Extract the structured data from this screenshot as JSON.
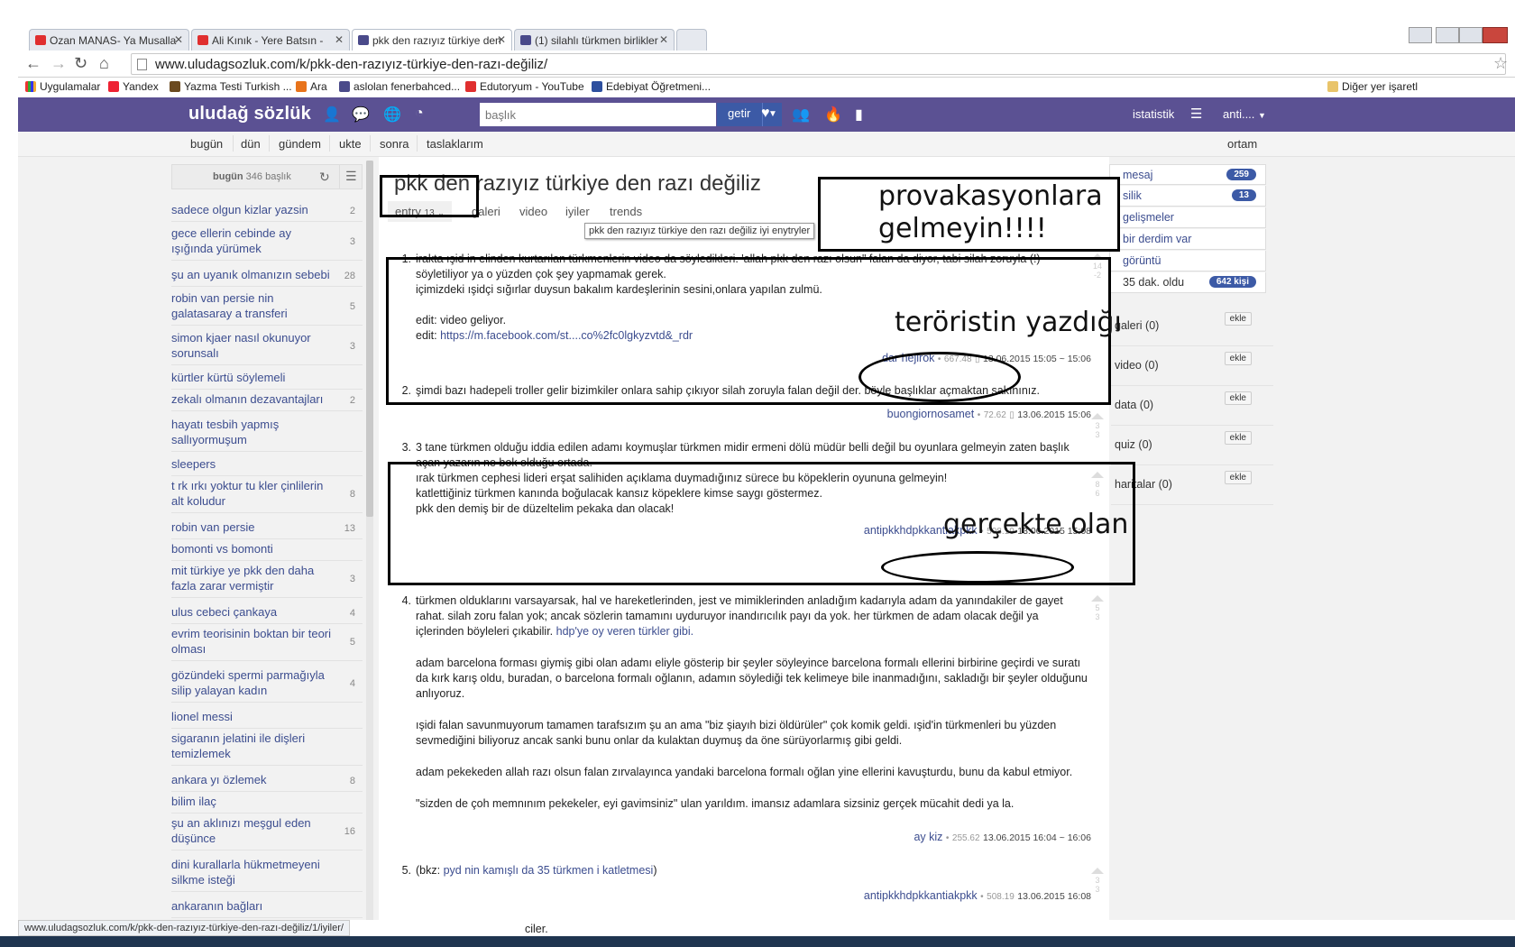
{
  "browser": {
    "tabs": [
      {
        "label": "Ozan MANAS- Ya Musalla",
        "icon": "youtube-icon"
      },
      {
        "label": "Ali Kınık - Yere Batsın - ",
        "icon": "youtube-icon"
      },
      {
        "label": "pkk den razıyız türkiye den",
        "icon": "uludag-icon"
      },
      {
        "label": "(1) silahlı türkmen birlikler",
        "icon": "uludag-icon"
      }
    ],
    "url": "www.uludagsozluk.com/k/pkk-den-razıyız-türkiye-den-razı-değiliz/",
    "bookmarks": [
      "Uygulamalar",
      "Yandex",
      "Yazma Testi Turkish ...",
      "Ara",
      "aslolan fenerbahced...",
      "Edutoryum - YouTube",
      "Edebiyat Öğretmeni..."
    ],
    "other_bookmarks": "Diğer yer işaretl",
    "status_url": "www.uludagsozluk.com/k/pkk-den-razıyız-türkiye-den-razı-değiliz/1/iyiler/"
  },
  "header": {
    "logo": "uludağ sözlük",
    "search_placeholder": "başlık",
    "search_button": "getir",
    "stats": "istatistik",
    "user": "anti....",
    "colors": {
      "header_bg": "#5b5193",
      "button_bg": "#3c5aa6"
    }
  },
  "subnav": {
    "items": [
      "bugün",
      "dün",
      "gündem",
      "ukte",
      "sonra",
      "taslaklarım"
    ],
    "right": "ortam"
  },
  "sidebar": {
    "head_label": "bugün",
    "head_count": "346 başlık",
    "items": [
      {
        "label": "sadece olgun kizlar yazsin",
        "count": "2"
      },
      {
        "label": "gece ellerin cebinde ay ışığında yürümek",
        "count": "3"
      },
      {
        "label": "şu an uyanık olmanızın sebebi",
        "count": "28"
      },
      {
        "label": "robin van persie nin galatasaray a transferi",
        "count": "5"
      },
      {
        "label": "simon kjaer nasıl okunuyor sorunsalı",
        "count": "3"
      },
      {
        "label": "kürtler kürtü söylemeli",
        "count": ""
      },
      {
        "label": "zekalı olmanın dezavantajları",
        "count": "2"
      },
      {
        "label": "hayatı tesbih yapmış sallıyormuşum",
        "count": ""
      },
      {
        "label": "sleepers",
        "count": ""
      },
      {
        "label": "t rk ırkı yoktur tu kler çinlilerin alt koludur",
        "count": "8"
      },
      {
        "label": "robin van persie",
        "count": "13"
      },
      {
        "label": "bomonti vs bomonti",
        "count": ""
      },
      {
        "label": "mit türkiye ye pkk den daha fazla zarar vermiştir",
        "count": "3"
      },
      {
        "label": "ulus cebeci çankaya",
        "count": "4"
      },
      {
        "label": "evrim teorisinin boktan bir teori olması",
        "count": "5"
      },
      {
        "label": "gözündeki spermi parmağıyla silip yalayan kadın",
        "count": "4"
      },
      {
        "label": "lionel messi",
        "count": ""
      },
      {
        "label": "sigaranın jelatini ile dişleri temizlemek",
        "count": ""
      },
      {
        "label": "ankara yı özlemek",
        "count": "8"
      },
      {
        "label": "bilim ilaç",
        "count": ""
      },
      {
        "label": "şu an aklınızı meşgul eden düşünce",
        "count": "16"
      },
      {
        "label": "dini kurallarla hükmetmeyeni silkme isteği",
        "count": ""
      },
      {
        "label": "ankaranın bağları",
        "count": ""
      }
    ]
  },
  "topic": {
    "title": "pkk den razıyız türkiye den razı değiliz",
    "tabs": {
      "entry": "entry",
      "entry_count": "13",
      "galeri": "galeri",
      "video": "video",
      "iyiler": "iyiler",
      "trends": "trends"
    },
    "tooltip": "pkk den razıyız türkiye den razı değiliz iyi enytryler",
    "ara": "ara"
  },
  "entries": [
    {
      "num": "1.",
      "lines": [
        "irakta ışid in elinden kurtarılan türkmenlerin video da söyledikleri. 'allah pkk den razı olsun\" falan da diyor, tabi silah zoruyla (!) söyletiliyor ya o yüzden çok şey yapmamak gerek.",
        "içimizdeki ışidçi sığırlar duysun bakalım kardeşlerinin sesini,onlara yapılan zulmü.",
        "",
        "edit: video geliyor."
      ],
      "edit_prefix": "edit: ",
      "edit_link": "https://m.facebook.com/st....co%2fc0lgkyzvtd&_rdr",
      "author": "dar hejirok",
      "score": "667.48",
      "date": "13.06.2015 15:05 ~ 15:06",
      "votes": [
        "14",
        "-2"
      ]
    },
    {
      "num": "2.",
      "lines": [
        "şimdi bazı hadepeli troller gelir bizimkiler onlara sahip çıkıyor silah zoruyla falan değil der. böyle başlıklar açmaktan sakınınız."
      ],
      "author": "buongiornosamet",
      "score": "72.62",
      "date": "13.06.2015 15:06",
      "votes": [
        "3",
        "3"
      ]
    },
    {
      "num": "3.",
      "lines": [
        "3 tane türkmen olduğu iddia edilen adamı koymuşlar türkmen midir ermeni dölü müdür belli değil bu oyunlara gelmeyin zaten başlık açan yazarın ne bok olduğu ortada.",
        "ırak türkmen cephesi lideri erşat salihiden açıklama duymadığınız sürece bu köpeklerin oyununa gelmeyin!",
        "katlettiğiniz türkmen kanında boğulacak kansız köpeklere kimse saygı göstermez.",
        "pkk den demiş bir de düzeltelim pekaka dan olacak!"
      ],
      "author": "antipkkhdpkkantiakpkk",
      "score": "508.19",
      "date": "13.06.2015 15:08",
      "votes": [
        "8",
        "6"
      ]
    },
    {
      "num": "4.",
      "paragraphs": [
        "türkmen olduklarını varsayarsak, hal ve hareketlerinden, jest ve mimiklerinden anladığım kadarıyla adam da yanındakiler de gayet rahat. silah zoru falan yok; ancak sözlerin tamamını uyduruyor inandırıcılık payı da yok. her türkmen de adam olacak değil ya içlerinden böyleleri çıkabilir.",
        "adam barcelona forması giymiş gibi olan adamı eliyle gösterip bir şeyler söyleyince barcelona formalı ellerini birbirine geçirdi ve suratı da kırk karış oldu, buradan, o barcelona formalı oğlanın, adamın söylediği tek kelimeye bile inanmadığını, sakladığı bir şeyler olduğunu anlıyoruz.",
        "ışidi falan savunmuyorum tamamen tarafsızım şu an ama \"biz şiayıh bizi öldürüler\" çok komik geldi. ışid'in türkmenleri bu yüzden sevmediğini biliyoruz ancak sanki bunu onlar da kulaktan duymuş da öne sürüyorlarmış gibi geldi.",
        "adam pekekeden allah razı olsun falan zırvalayınca yandaki barcelona formalı oğlan yine ellerini kavuşturdu, bunu da kabul etmiyor.",
        "\"sizden de çoh memnınım pekekeler, eyi gavimsiniz\" ulan yarıldım. imansız adamlara sizsiniz gerçek mücahit dedi ya la."
      ],
      "link_text": "hdp'ye oy veren türkler gibi.",
      "author": "ay kiz",
      "score": "255.62",
      "date": "13.06.2015 16:04 ~ 16:06",
      "votes": [
        "5",
        "3"
      ]
    },
    {
      "num": "5.",
      "bkz_prefix": "(bkz: ",
      "bkz_link": "pyd nin kamışlı da 35 türkmen i katletmesi",
      "bkz_suffix": ")",
      "author": "antipkkhdpkkantiakpkk",
      "score": "508.19",
      "date": "13.06.2015 16:08",
      "votes": [
        "3",
        "3"
      ]
    }
  ],
  "partial_text": "ciler.",
  "right_panel": {
    "rows": [
      {
        "label": "mesaj",
        "badge": "259"
      },
      {
        "label": "silik",
        "badge": "13"
      },
      {
        "label": "gelişmeler",
        "badge": ""
      },
      {
        "label": "bir derdim var",
        "badge": ""
      },
      {
        "label": "görüntü",
        "badge": ""
      },
      {
        "label": "35 dak. oldu",
        "badge": "642 kişi"
      }
    ],
    "sections": [
      {
        "label": "galeri (0)",
        "button": "ekle"
      },
      {
        "label": "video (0)",
        "button": "ekle"
      },
      {
        "label": "data (0)",
        "button": "ekle"
      },
      {
        "label": "quiz (0)",
        "button": "ekle"
      },
      {
        "label": "haritalar (0)",
        "button": "ekle"
      }
    ]
  },
  "annotations": {
    "provakasyon": "provakasyonlara gelmeyin!!!!",
    "teror": "teröristin yazdığı",
    "gercek": "gerçekte olan"
  }
}
